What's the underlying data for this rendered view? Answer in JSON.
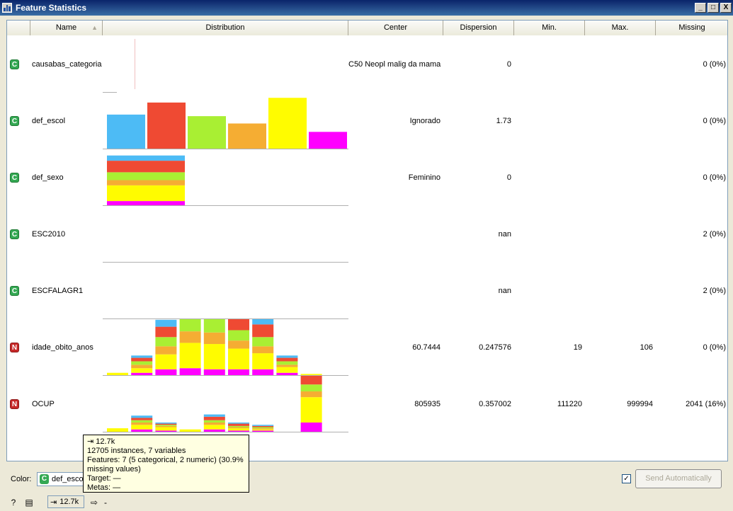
{
  "window": {
    "title": "Feature Statistics",
    "buttons": [
      "_",
      "□",
      "X"
    ]
  },
  "table": {
    "headers": [
      "Name",
      "Distribution",
      "Center",
      "Dispersion",
      "Min.",
      "Max.",
      "Missing"
    ],
    "rows": [
      {
        "type": "C",
        "name": "causabas_categoria",
        "center": "C50   Neopl malig da mama",
        "dispersion": "0",
        "min": "",
        "max": "",
        "missing": "0 (0%)"
      },
      {
        "type": "C",
        "name": "def_escol",
        "center": "Ignorado",
        "dispersion": "1.73",
        "min": "",
        "max": "",
        "missing": "0 (0%)"
      },
      {
        "type": "C",
        "name": "def_sexo",
        "center": "Feminino",
        "dispersion": "0",
        "min": "",
        "max": "",
        "missing": "0 (0%)"
      },
      {
        "type": "C",
        "name": "ESC2010",
        "center": "",
        "dispersion": "nan",
        "min": "",
        "max": "",
        "missing": "2 (0%)"
      },
      {
        "type": "C",
        "name": "ESCFALAGR1",
        "center": "",
        "dispersion": "nan",
        "min": "",
        "max": "",
        "missing": "2 (0%)"
      },
      {
        "type": "N",
        "name": "idade_obito_anos",
        "center": "60.7444",
        "dispersion": "0.247576",
        "min": "19",
        "max": "106",
        "missing": "0 (0%)"
      },
      {
        "type": "N",
        "name": "OCUP",
        "center": "805935",
        "dispersion": "0.357002",
        "min": "111220",
        "max": "999994",
        "missing": "2041 (16%)"
      }
    ]
  },
  "palette": [
    "#4dbbf5",
    "#ef4a33",
    "#a9ef33",
    "#f5ad33",
    "#fffc00",
    "#ff00ff"
  ],
  "chart_data": [
    {
      "type": "bar",
      "feature": "def_escol",
      "values": [
        0.65,
        0.88,
        0.62,
        0.48,
        0.97,
        0.32
      ]
    },
    {
      "type": "bar",
      "feature": "def_sexo",
      "series": [
        {
          "stack": [
            0.1,
            0.22,
            0.15,
            0.1,
            0.3,
            0.08
          ]
        }
      ],
      "categories": [
        "Feminino"
      ]
    },
    {
      "type": "bar",
      "feature": "idade_obito_anos",
      "bins": [
        [
          0,
          0,
          0,
          0,
          0.02,
          0
        ],
        [
          0.02,
          0.03,
          0.03,
          0.03,
          0.04,
          0.02
        ],
        [
          0.06,
          0.09,
          0.08,
          0.07,
          0.13,
          0.05
        ],
        [
          0.15,
          0.17,
          0.15,
          0.1,
          0.22,
          0.06
        ],
        [
          0.12,
          0.18,
          0.12,
          0.1,
          0.22,
          0.05
        ],
        [
          0.1,
          0.13,
          0.09,
          0.07,
          0.18,
          0.05
        ],
        [
          0.06,
          0.11,
          0.08,
          0.06,
          0.14,
          0.05
        ],
        [
          0.02,
          0.03,
          0.03,
          0.02,
          0.05,
          0.02
        ],
        [
          0,
          0,
          0,
          0,
          0.01,
          0
        ]
      ]
    },
    {
      "type": "bar",
      "feature": "OCUP",
      "bins": [
        [
          0,
          0,
          0,
          0,
          0.03,
          0
        ],
        [
          0.02,
          0.02,
          0.02,
          0.02,
          0.04,
          0.02
        ],
        [
          0.01,
          0.01,
          0.01,
          0.01,
          0.03,
          0.01
        ],
        [
          0,
          0,
          0,
          0,
          0.02,
          0
        ],
        [
          0.02,
          0.03,
          0.02,
          0.02,
          0.04,
          0.02
        ],
        [
          0.01,
          0.02,
          0.01,
          0.01,
          0.02,
          0.01
        ],
        [
          0.01,
          0.01,
          0.01,
          0.01,
          0.01,
          0.01
        ],
        [
          0,
          0,
          0,
          0,
          0,
          0
        ],
        [
          0.2,
          0.23,
          0.06,
          0.05,
          0.22,
          0.08
        ]
      ]
    }
  ],
  "footer": {
    "color_label": "Color:",
    "color_value": "def_escol",
    "color_badge": "C",
    "send_auto_checked": "✓",
    "send_button": "Send Automatically",
    "status_count": "12.7k",
    "status_out": "-"
  },
  "tooltip": {
    "count": "12.7k",
    "line1": "12705 instances, 7 variables",
    "line2": "Features: 7 (5 categorical, 2 numeric) (30.9%",
    "line3": "missing values)",
    "line4": "Target: —",
    "line5": "Metas: —"
  }
}
